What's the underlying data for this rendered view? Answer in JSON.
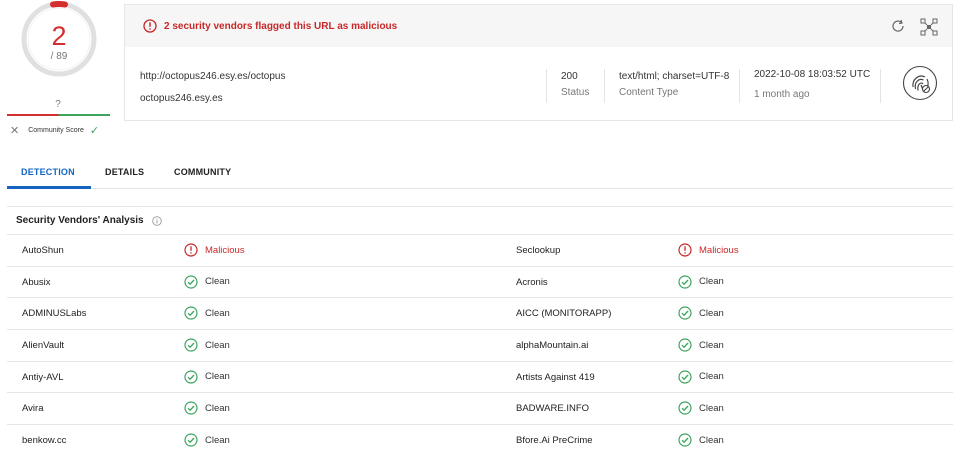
{
  "score": {
    "detections": "2",
    "total": "/ 89",
    "community_label": "Community Score",
    "community_value": "?"
  },
  "alert": {
    "text": "2 security vendors flagged this URL as malicious"
  },
  "details": {
    "url": "http://octopus246.esy.es/octopus",
    "host": "octopus246.esy.es",
    "status_value": "200",
    "status_label": "Status",
    "content_type_value": "text/html; charset=UTF-8",
    "content_type_label": "Content Type",
    "date": "2022-10-08 18:03:52 UTC",
    "date_ago": "1 month ago"
  },
  "tabs": [
    {
      "label": "DETECTION",
      "active": true
    },
    {
      "label": "DETAILS",
      "active": false
    },
    {
      "label": "COMMUNITY",
      "active": false
    }
  ],
  "section": {
    "title": "Security Vendors' Analysis"
  },
  "vendors": [
    {
      "left_name": "AutoShun",
      "left_result": "Malicious",
      "right_name": "Seclookup",
      "right_result": "Malicious"
    },
    {
      "left_name": "Abusix",
      "left_result": "Clean",
      "right_name": "Acronis",
      "right_result": "Clean"
    },
    {
      "left_name": "ADMINUSLabs",
      "left_result": "Clean",
      "right_name": "AICC (MONITORAPP)",
      "right_result": "Clean"
    },
    {
      "left_name": "AlienVault",
      "left_result": "Clean",
      "right_name": "alphaMountain.ai",
      "right_result": "Clean"
    },
    {
      "left_name": "Antiy-AVL",
      "left_result": "Clean",
      "right_name": "Artists Against 419",
      "right_result": "Clean"
    },
    {
      "left_name": "Avira",
      "left_result": "Clean",
      "right_name": "BADWARE.INFO",
      "right_result": "Clean"
    },
    {
      "left_name": "benkow.cc",
      "left_result": "Clean",
      "right_name": "Bfore.Ai PreCrime",
      "right_result": "Clean"
    }
  ],
  "colors": {
    "malicious": "#c62828",
    "clean": "#3ba55d",
    "accent": "#1565c0"
  }
}
